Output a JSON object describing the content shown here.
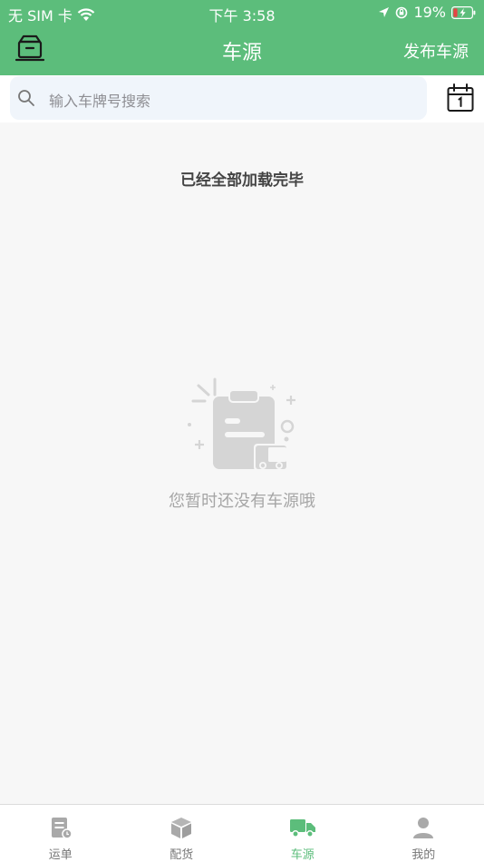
{
  "status_bar": {
    "carrier": "无 SIM 卡",
    "time": "下午 3:58",
    "battery": "19%"
  },
  "nav": {
    "title": "车源",
    "right_action": "发布车源"
  },
  "search": {
    "placeholder": "输入车牌号搜索"
  },
  "list": {
    "footer_text": "已经全部加载完毕"
  },
  "empty_state": {
    "message": "您暂时还没有车源哦"
  },
  "tabbar": {
    "tabs": [
      {
        "label": "运单",
        "icon": "waybill-icon"
      },
      {
        "label": "配货",
        "icon": "package-icon"
      },
      {
        "label": "车源",
        "icon": "truck-icon",
        "active": true
      },
      {
        "label": "我的",
        "icon": "profile-icon"
      }
    ]
  },
  "colors": {
    "brand": "#5cbd7b",
    "search_bg": "#f0f5fb",
    "page_bg": "#f7f7f7"
  }
}
